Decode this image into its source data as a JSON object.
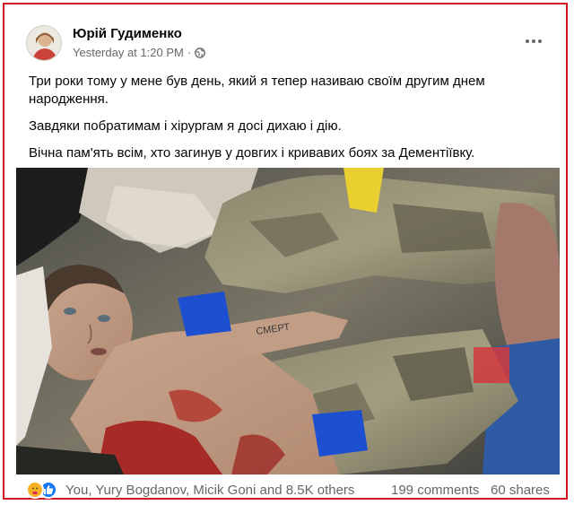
{
  "post": {
    "author": "Юрій Гудименко",
    "timestamp": "Yesterday at 1:20 PM",
    "separator": "·",
    "privacy_icon": "globe-icon",
    "more_icon": "more-options-icon",
    "paragraphs": [
      "Три роки тому у мене був день, який я тепер називаю своїм другим днем народження.",
      "Завдяки побратимам і хірургам я досі дихаю і дію.",
      "Вічна пам'ять всім, хто загинув у довгих і кривавих боях за Дементіївку."
    ],
    "photo_text": "СМЕРТ"
  },
  "footer": {
    "reaction_icons": [
      "care-icon",
      "like-icon"
    ],
    "reactors": "You, Yury Bogdanov, Micik Goni and 8.5K others",
    "comments": "199 comments",
    "shares": "60 shares"
  },
  "colors": {
    "frame_border": "#d2141e",
    "like_blue": "#1877f2",
    "care_yellow": "#f7b125",
    "secondary_text": "#65676b"
  }
}
